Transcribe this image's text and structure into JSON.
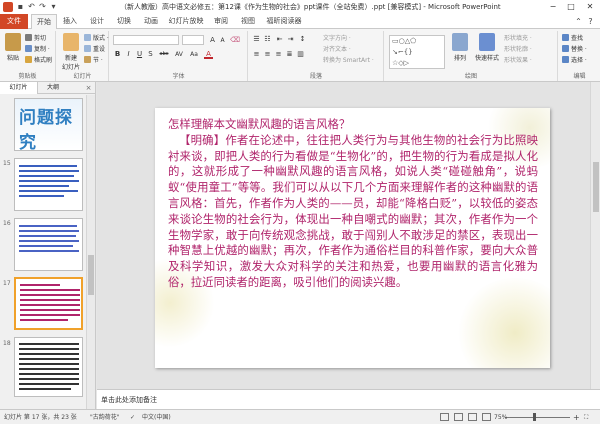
{
  "window": {
    "title": "（新人教版）高中语文必修五：第12课《作为生物的社会》ppt课件（全站免费）.ppt [兼容模式] - Microsoft PowerPoint",
    "minimize": "−",
    "maximize": "□",
    "close": "✕"
  },
  "tabs": {
    "file": "文件",
    "items": [
      "开始",
      "插入",
      "设计",
      "切换",
      "动画",
      "幻灯片放映",
      "审阅",
      "视图",
      "福昕阅读器"
    ],
    "active": "开始"
  },
  "ribbon": {
    "clipboard": {
      "label": "剪贴板",
      "paste": "粘贴",
      "cut": "剪切",
      "copy": "复制 ·",
      "format_painter": "格式刷"
    },
    "slides": {
      "label": "幻灯片",
      "new_slide": "新建\n幻灯片",
      "layout": "版式 ·",
      "reset": "重设",
      "section": "节 ·"
    },
    "font": {
      "label": "字体",
      "bold": "B",
      "italic": "I",
      "underline": "U",
      "strike": "S",
      "shadow": "abc",
      "spacing": "AV",
      "case": "Aa",
      "color": "A"
    },
    "paragraph": {
      "label": "段落",
      "text_direction": "文字方向 ·",
      "align_text": "对齐文本 ·",
      "smartart": "转换为 SmartArt ·"
    },
    "drawing": {
      "label": "绘图",
      "arrange": "排列",
      "quick_styles": "快速样式",
      "shape_fill": "形状填充 ·",
      "shape_outline": "形状轮廓 ·",
      "shape_effects": "形状效果 ·"
    },
    "editing": {
      "label": "编辑",
      "find": "查找",
      "replace": "替换 ·",
      "select": "选择 ·"
    }
  },
  "left_panel": {
    "tab_slides": "幻灯片",
    "tab_outline": "大纲",
    "close": "×",
    "thumbnails": [
      {
        "number": "",
        "title": "问题探究"
      },
      {
        "number": "15",
        "title": ""
      },
      {
        "number": "16",
        "title": ""
      },
      {
        "number": "17",
        "title": ""
      },
      {
        "number": "18",
        "title": ""
      }
    ]
  },
  "slide": {
    "heading": "怎样理解本文幽默风趣的语言风格？",
    "body": "【明确】作者在论述中，往往把人类行为与其他生物的社会行为比照映衬来谈，即把人类的行为看做是“生物化”的，把生物的行为看成是拟人化的，这就形成了一种幽默风趣的语言风格，如说人类“碰碰触角”，说蚂蚁“使用童工”等等。我们可以从以下几个方面来理解作者的这种幽默的语言风格：首先，作者作为人类的——员，却能“降格白贬”，以较低的姿态来谈论生物的社会行为，体现出一种自嘲式的幽默；其次，作者作为一个生物学家，敢于向传统观念挑战，敢于闯别人不敢涉足的禁区，表现出一种智慧上优越的幽默；再次，作者作为通俗栏目的科普作家，要向大众普及科学知识，激发大众对科学的关注和热爱，也要用幽默的语言化雅为俗，拉近同读者的距离，吸引他们的阅读兴趣。"
  },
  "notes": {
    "placeholder": "单击此处添加备注"
  },
  "status": {
    "slide_info": "幻灯片 第 17 张，共 23 张",
    "theme": "\"古韵荷花\"",
    "language": "中文(中国)",
    "zoom": "75%",
    "zoom_level": 75
  }
}
